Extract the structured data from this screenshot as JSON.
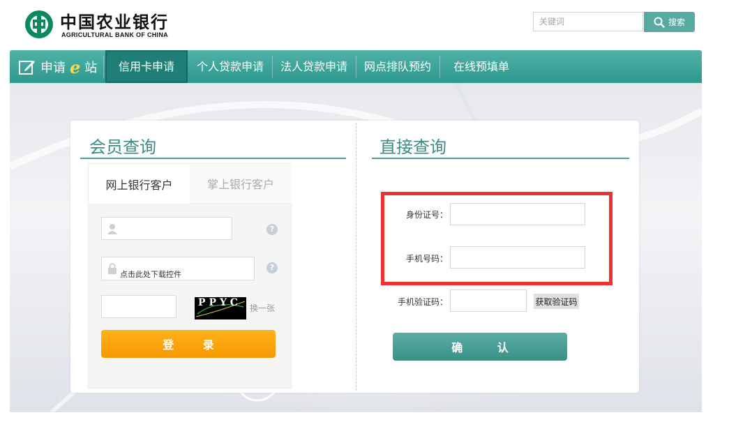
{
  "header": {
    "bank_name_cn": "中国农业银行",
    "bank_name_en": "AGRICULTURAL BANK OF CHINA",
    "search_placeholder": "关键词",
    "search_button": "搜索"
  },
  "nav": {
    "brand_prefix": "申请",
    "brand_e": "e",
    "brand_suffix": "站",
    "items": [
      {
        "label": "信用卡申请",
        "active": true
      },
      {
        "label": "个人贷款申请",
        "active": false
      },
      {
        "label": "法人贷款申请",
        "active": false
      },
      {
        "label": "网点排队预约",
        "active": false
      },
      {
        "label": "在线预填单",
        "active": false
      }
    ]
  },
  "member": {
    "title": "会员查询",
    "tabs": [
      "网上银行客户",
      "掌上银行客户"
    ],
    "password_hint": "点击此处下载控件",
    "captcha_text": "PPYC",
    "refresh_label": "换一张",
    "login_button": "登 录",
    "help_symbol": "?"
  },
  "direct": {
    "title": "直接查询",
    "id_label": "身份证号：",
    "phone_label": "手机号码：",
    "code_label": "手机验证码：",
    "get_code_button": "获取验证码",
    "confirm_button": "确 认"
  },
  "colors": {
    "brand": "#2f978d",
    "login": "#f59800",
    "highlight": "#ee3131"
  }
}
